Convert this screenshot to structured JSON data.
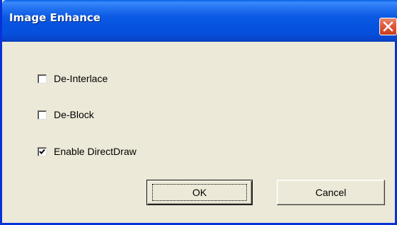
{
  "window": {
    "title": "Image Enhance"
  },
  "title_bar": {
    "close_icon": "close-x-icon"
  },
  "options": [
    {
      "label": "De-Interlace",
      "checked": false
    },
    {
      "label": "De-Block",
      "checked": false
    },
    {
      "label": "Enable DirectDraw",
      "checked": true
    }
  ],
  "buttons": {
    "ok_label": "OK",
    "cancel_label": "Cancel"
  },
  "colors": {
    "title_bar": "#0653e0",
    "close_button": "#e0583a",
    "dialog_background": "#ece9d8"
  }
}
